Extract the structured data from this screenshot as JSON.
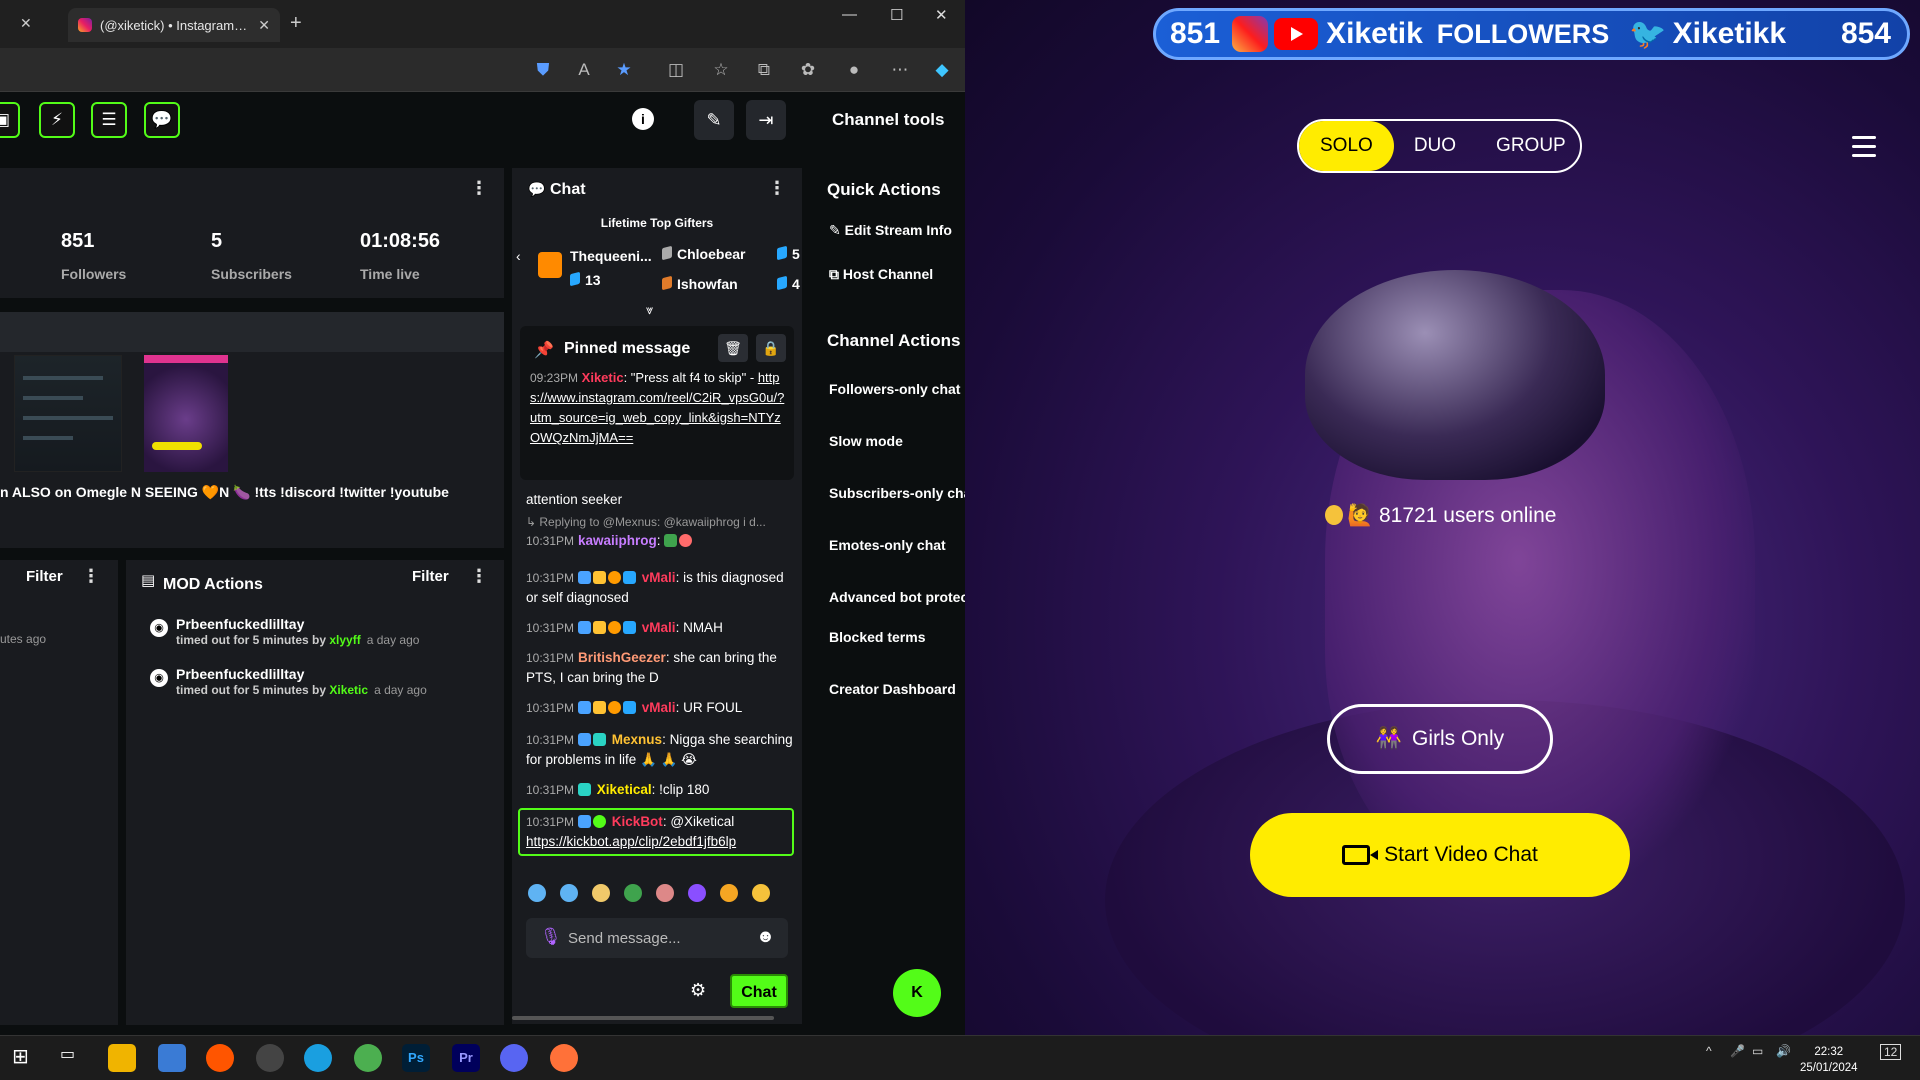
{
  "browser": {
    "tab_title": "(@xiketick) • Instagram phot",
    "new_tab": "+",
    "close": "✕",
    "minimize": "—",
    "maximize": "☐",
    "window_close": "✕"
  },
  "toolbar": {
    "channel_tools_label": "Channel tools",
    "info": "i"
  },
  "stats": {
    "followers_value": "851",
    "followers_label": "Followers",
    "subscribers_value": "5",
    "subscribers_label": "Subscribers",
    "time_value": "01:08:56",
    "time_label": "Time live"
  },
  "stream": {
    "title_line": "n ALSO on Omegle N SEEING 🧡N 🍆 !tts !discord !twitter !youtube"
  },
  "left_panel": {
    "filter_label": "Filter",
    "partial_ago": "utes ago"
  },
  "mod_actions": {
    "title": "MOD Actions",
    "filter_label": "Filter",
    "items": [
      {
        "user": "Prbeenfuckedlilltay",
        "action": "timed out for 5 minutes by",
        "by": "xlyyff",
        "ago": "a day ago"
      },
      {
        "user": "Prbeenfuckedlilltay",
        "action": "timed out for 5 minutes by",
        "by": "Xiketic",
        "ago": "a day ago"
      }
    ]
  },
  "chat": {
    "title": "Chat",
    "gifters_title": "Lifetime Top Gifters",
    "gifters": [
      {
        "name": "Thequeeni...",
        "count": "13"
      },
      {
        "name": "Chloebear",
        "count": "5"
      },
      {
        "name": "Ishowfan",
        "count": "4"
      }
    ],
    "pinned": {
      "title": "Pinned message",
      "time": "09:23PM",
      "user": "Xiketic",
      "text": ": \"Press alt f4 to skip\"",
      "dash": " - ",
      "link": "https://www.instagram.com/reel/C2iR_vpsG0u/?utm_source=ig_web_copy_link&igsh=NTYzOWQzNmJjMA=="
    },
    "messages": [
      {
        "text": "attention seeker"
      },
      {
        "reply": "↳ Replying to @Mexnus: @kawaiiphrog i d..."
      },
      {
        "time": "10:31PM",
        "user": "kawaiiphrog",
        "color": "#c77dff",
        "text": ":"
      },
      {
        "time": "10:31PM",
        "user": "vMali",
        "color": "#ff3b5c",
        "text": ": is this diagnosed or self diagnosed"
      },
      {
        "time": "10:31PM",
        "user": "vMali",
        "color": "#ff3b5c",
        "text": ": NMAH"
      },
      {
        "time": "10:31PM",
        "user": "BritishGeezer",
        "color": "#ff9a76",
        "text": ": she can bring the PTS, I can bring the D"
      },
      {
        "time": "10:31PM",
        "user": "vMali",
        "color": "#ff3b5c",
        "text": ": UR FOUL"
      },
      {
        "time": "10:31PM",
        "user": "Mexnus",
        "color": "#ffc233",
        "text": ": Nigga she searching for problems in life 🙏 🙏 😭"
      },
      {
        "time": "10:31PM",
        "user": "Xiketical",
        "color": "#ffec00",
        "text": ": !clip 180"
      },
      {
        "time": "10:31PM",
        "user": "KickBot",
        "color": "#ff3b5c",
        "text": ": @Xiketical",
        "link": "https://kickbot.app/clip/2ebdf1jfb6lp"
      }
    ],
    "send_placeholder": "Send message...",
    "send_button": "Chat"
  },
  "quick_actions": {
    "title": "Quick Actions",
    "items": [
      "Edit Stream Info",
      "Host Channel"
    ]
  },
  "channel_actions": {
    "title": "Channel Actions",
    "items": [
      "Followers-only chat",
      "Slow mode",
      "Subscribers-only chat",
      "Emotes-only chat",
      "Advanced bot protection",
      "Blocked terms",
      "Creator Dashboard"
    ]
  },
  "video": {
    "banner": {
      "followers_left": "851",
      "name": "Xiketik",
      "followers_word": "FOLLOWERS",
      "twitter": "Xiketikk",
      "followers_right": "854"
    },
    "modes": [
      "SOLO",
      "DUO",
      "GROUP"
    ],
    "active_mode": "SOLO",
    "online": "🙋 81721 users online",
    "girls_only": "Girls Only",
    "start": "Start Video Chat"
  },
  "taskbar": {
    "time": "22:32",
    "date": "25/01/2024",
    "notif": "12"
  },
  "colors": {
    "kick_green": "#53fc18",
    "video_yellow": "#ffec00"
  }
}
